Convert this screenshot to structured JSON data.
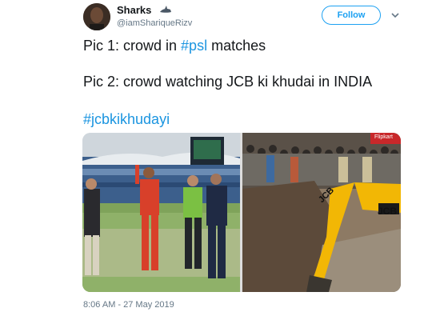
{
  "tweet": {
    "author_name": "Sharks",
    "author_handle": "@iamShariqueRizv",
    "follow_label": "Follow",
    "lines": [
      {
        "parts": [
          {
            "text": "Pic 1: crowd in ",
            "tag": false
          },
          {
            "text": "#psl",
            "tag": true
          },
          {
            "text": "  matches",
            "tag": false
          }
        ]
      },
      {
        "parts": [
          {
            "text": "Pic 2: crowd watching JCB ki khudai in INDIA",
            "tag": false
          }
        ]
      },
      {
        "parts": [
          {
            "text": "#jcbkikhudayi",
            "tag": true
          }
        ]
      }
    ],
    "timestamp": "8:06 AM - 27 May 2019"
  },
  "media": {
    "pic1": {
      "scoreboard_label": "",
      "sign_text": ""
    },
    "pic2": {
      "machine_label": "JCB",
      "logo_text": "JCB",
      "sign_text": "Flipkart"
    }
  },
  "icons": [
    "shark-icon",
    "chevron-down-icon"
  ],
  "colors": {
    "link": "#1b95e0",
    "follow_border": "#1da1f2",
    "jcb_yellow": "#f2b705"
  }
}
